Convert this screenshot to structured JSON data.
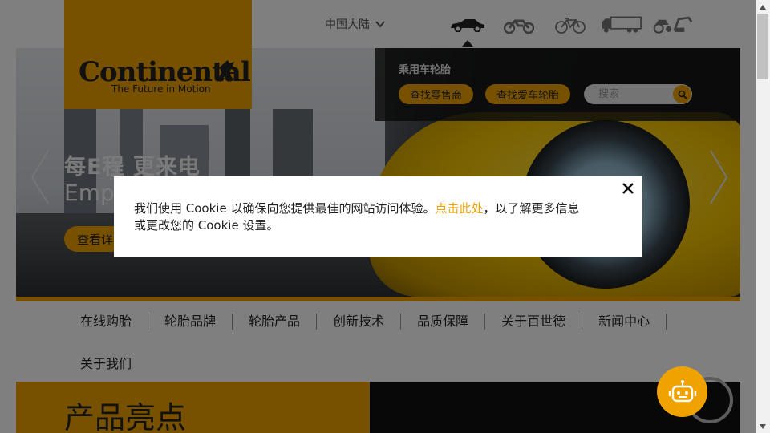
{
  "header": {
    "region_label": "中国大陆",
    "vehicles": [
      {
        "name": "car-icon",
        "active": true
      },
      {
        "name": "motorcycle-icon",
        "active": false
      },
      {
        "name": "bicycle-icon",
        "active": false
      },
      {
        "name": "truck-icon",
        "active": false
      },
      {
        "name": "industrial-vehicle-icon",
        "active": false
      }
    ]
  },
  "logo": {
    "wordmark": "Continental",
    "tagline": "The Future in Motion",
    "icon": "horse-icon"
  },
  "finder": {
    "title": "乘用车轮胎",
    "dealer_button": "查找零售商",
    "mycar_button": "查找爱车轮胎",
    "search_placeholder": "搜索"
  },
  "hero": {
    "title": "每E程 更来电",
    "subtitle": "Empo",
    "button_label": "查看详"
  },
  "nav": {
    "items": [
      "在线购胎",
      "轮胎品牌",
      "轮胎产品",
      "创新技术",
      "品质保障",
      "关于百世德",
      "新闻中心"
    ],
    "row2_item": "关于我们"
  },
  "highlights": {
    "title": "产品亮点"
  },
  "cookie": {
    "text_before": "我们使用 Cookie 以确保向您提供最佳的网站访问体验。",
    "link_text": "点击此处",
    "text_after": "，以了解更多信息或更改您的 Cookie 设置。"
  },
  "colors": {
    "brand": "#f0a300",
    "overlay": "rgba(0,0,0,0.5)",
    "dark_panel": "#141414"
  }
}
